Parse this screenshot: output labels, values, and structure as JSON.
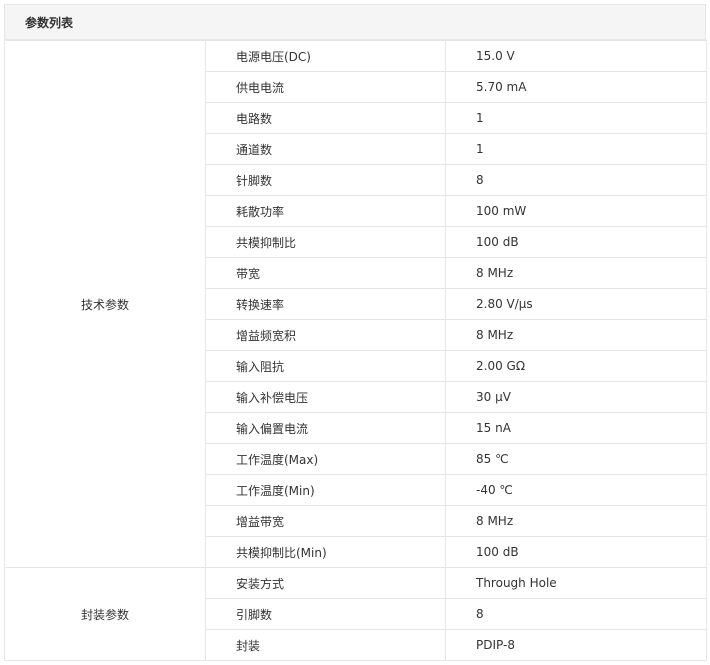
{
  "title": "参数列表",
  "groups": [
    {
      "name": "技术参数",
      "rows": [
        {
          "name": "电源电压(DC)",
          "value": "15.0 V"
        },
        {
          "name": "供电电流",
          "value": "5.70 mA"
        },
        {
          "name": "电路数",
          "value": "1"
        },
        {
          "name": "通道数",
          "value": "1"
        },
        {
          "name": "针脚数",
          "value": "8"
        },
        {
          "name": "耗散功率",
          "value": "100 mW"
        },
        {
          "name": "共模抑制比",
          "value": "100 dB"
        },
        {
          "name": "带宽",
          "value": "8 MHz"
        },
        {
          "name": "转换速率",
          "value": "2.80 V/μs"
        },
        {
          "name": "增益频宽积",
          "value": "8 MHz"
        },
        {
          "name": "输入阻抗",
          "value": "2.00 GΩ"
        },
        {
          "name": "输入补偿电压",
          "value": "30 μV"
        },
        {
          "name": "输入偏置电流",
          "value": "15 nA"
        },
        {
          "name": "工作温度(Max)",
          "value": "85 ℃"
        },
        {
          "name": "工作温度(Min)",
          "value": "-40 ℃"
        },
        {
          "name": "增益带宽",
          "value": "8 MHz"
        },
        {
          "name": "共模抑制比(Min)",
          "value": "100 dB"
        }
      ]
    },
    {
      "name": "封装参数",
      "rows": [
        {
          "name": "安装方式",
          "value": "Through Hole"
        },
        {
          "name": "引脚数",
          "value": "8"
        },
        {
          "name": "封装",
          "value": "PDIP-8"
        }
      ]
    }
  ]
}
